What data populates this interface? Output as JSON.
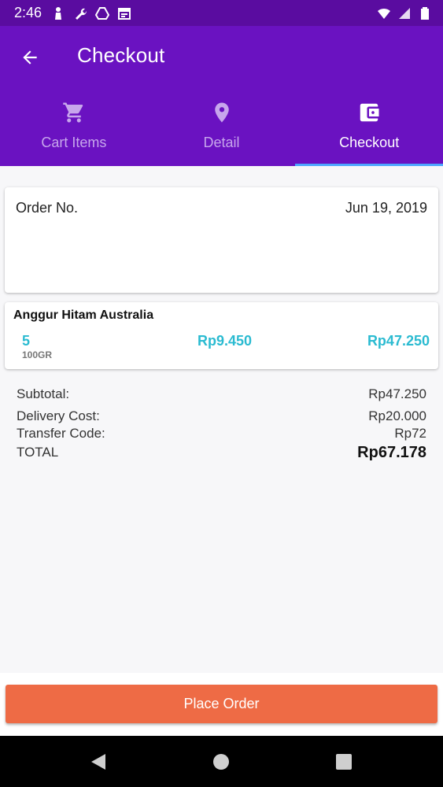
{
  "status_bar": {
    "time": "2:46",
    "left_icons": [
      "notification-person-icon",
      "wrench-icon",
      "drive-icon",
      "calendar-icon"
    ],
    "right_icons": [
      "wifi-icon",
      "signal-icon",
      "battery-icon"
    ]
  },
  "app_bar": {
    "title": "Checkout",
    "back_icon": "arrow-back-icon",
    "color": "#6a12c1"
  },
  "tabs": [
    {
      "label": "Cart Items",
      "icon": "cart-icon",
      "active": false
    },
    {
      "label": "Detail",
      "icon": "location-pin-icon",
      "active": false
    },
    {
      "label": "Checkout",
      "icon": "wallet-icon",
      "active": true
    }
  ],
  "order": {
    "label": "Order No.",
    "date": "Jun 19, 2019"
  },
  "items": [
    {
      "name": "Anggur Hitam Australia",
      "quantity": "5",
      "unit": "100GR",
      "price": "Rp9.450",
      "total": "Rp47.250"
    }
  ],
  "summary": {
    "subtotal_label": "Subtotal:",
    "subtotal_value": "Rp47.250",
    "delivery_label": "Delivery Cost:",
    "delivery_value": "Rp20.000",
    "transfer_label": "Transfer Code:",
    "transfer_value": "Rp72",
    "total_label": "TOTAL",
    "total_value": "Rp67.178"
  },
  "actions": {
    "place_order_label": "Place Order",
    "place_order_color": "#ee6b45"
  },
  "nav": [
    "back-triangle-icon",
    "home-circle-icon",
    "recents-square-icon"
  ]
}
